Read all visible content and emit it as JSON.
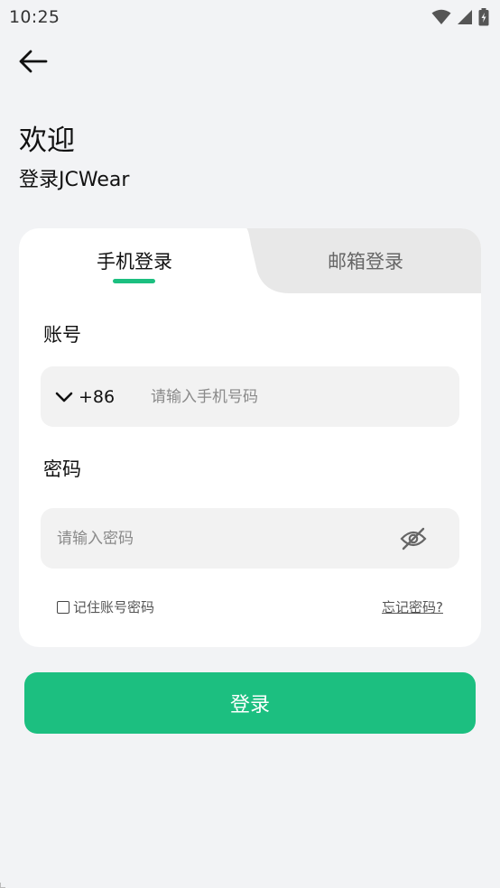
{
  "status_bar": {
    "time": "10:25",
    "icons": [
      "wifi-icon",
      "signal-icon",
      "battery-icon"
    ]
  },
  "header": {
    "back_icon": "arrow-left-icon",
    "title": "欢迎",
    "subtitle": "登录JCWear"
  },
  "tabs": [
    {
      "label": "手机登录",
      "active": true
    },
    {
      "label": "邮箱登录",
      "active": false
    }
  ],
  "form": {
    "account_label": "账号",
    "country_code": "+86",
    "phone_placeholder": "请输入手机号码",
    "password_label": "密码",
    "password_placeholder": "请输入密码",
    "remember_label": "记住账号密码",
    "forgot_label": "忘记密码?"
  },
  "login_button_label": "登录",
  "colors": {
    "accent": "#1cbf80",
    "background": "#f2f3f5",
    "input_bg": "#f2f2f2",
    "inactive_tab_bg": "#e8e8e8"
  }
}
